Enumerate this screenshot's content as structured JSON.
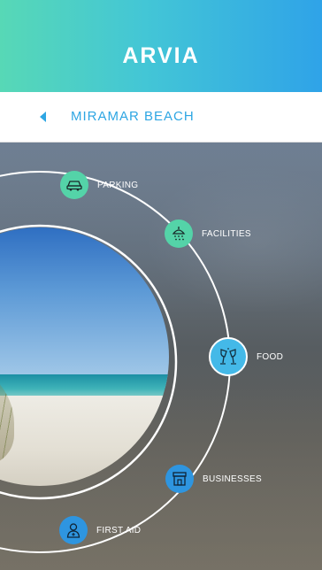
{
  "app": {
    "title": "ARVIA"
  },
  "breadcrumb": {
    "label": "MIRAMAR BEACH",
    "back_icon": "back-arrow-icon"
  },
  "menu": {
    "items": [
      {
        "label": "PARKING",
        "icon": "car-icon",
        "color": "#54d3a8"
      },
      {
        "label": "FACILITIES",
        "icon": "shower-icon",
        "color": "#54d3a8"
      },
      {
        "label": "FOOD",
        "icon": "drinks-icon",
        "color": "#44b9e8",
        "active": true
      },
      {
        "label": "BUSINESSES",
        "icon": "store-icon",
        "color": "#2e95e0"
      },
      {
        "label": "FIRST AID",
        "icon": "doctor-icon",
        "color": "#2e95e0"
      }
    ]
  },
  "colors": {
    "accent": "#2ea6e3",
    "header_start": "#57d8b6",
    "header_end": "#2fa3e8"
  }
}
